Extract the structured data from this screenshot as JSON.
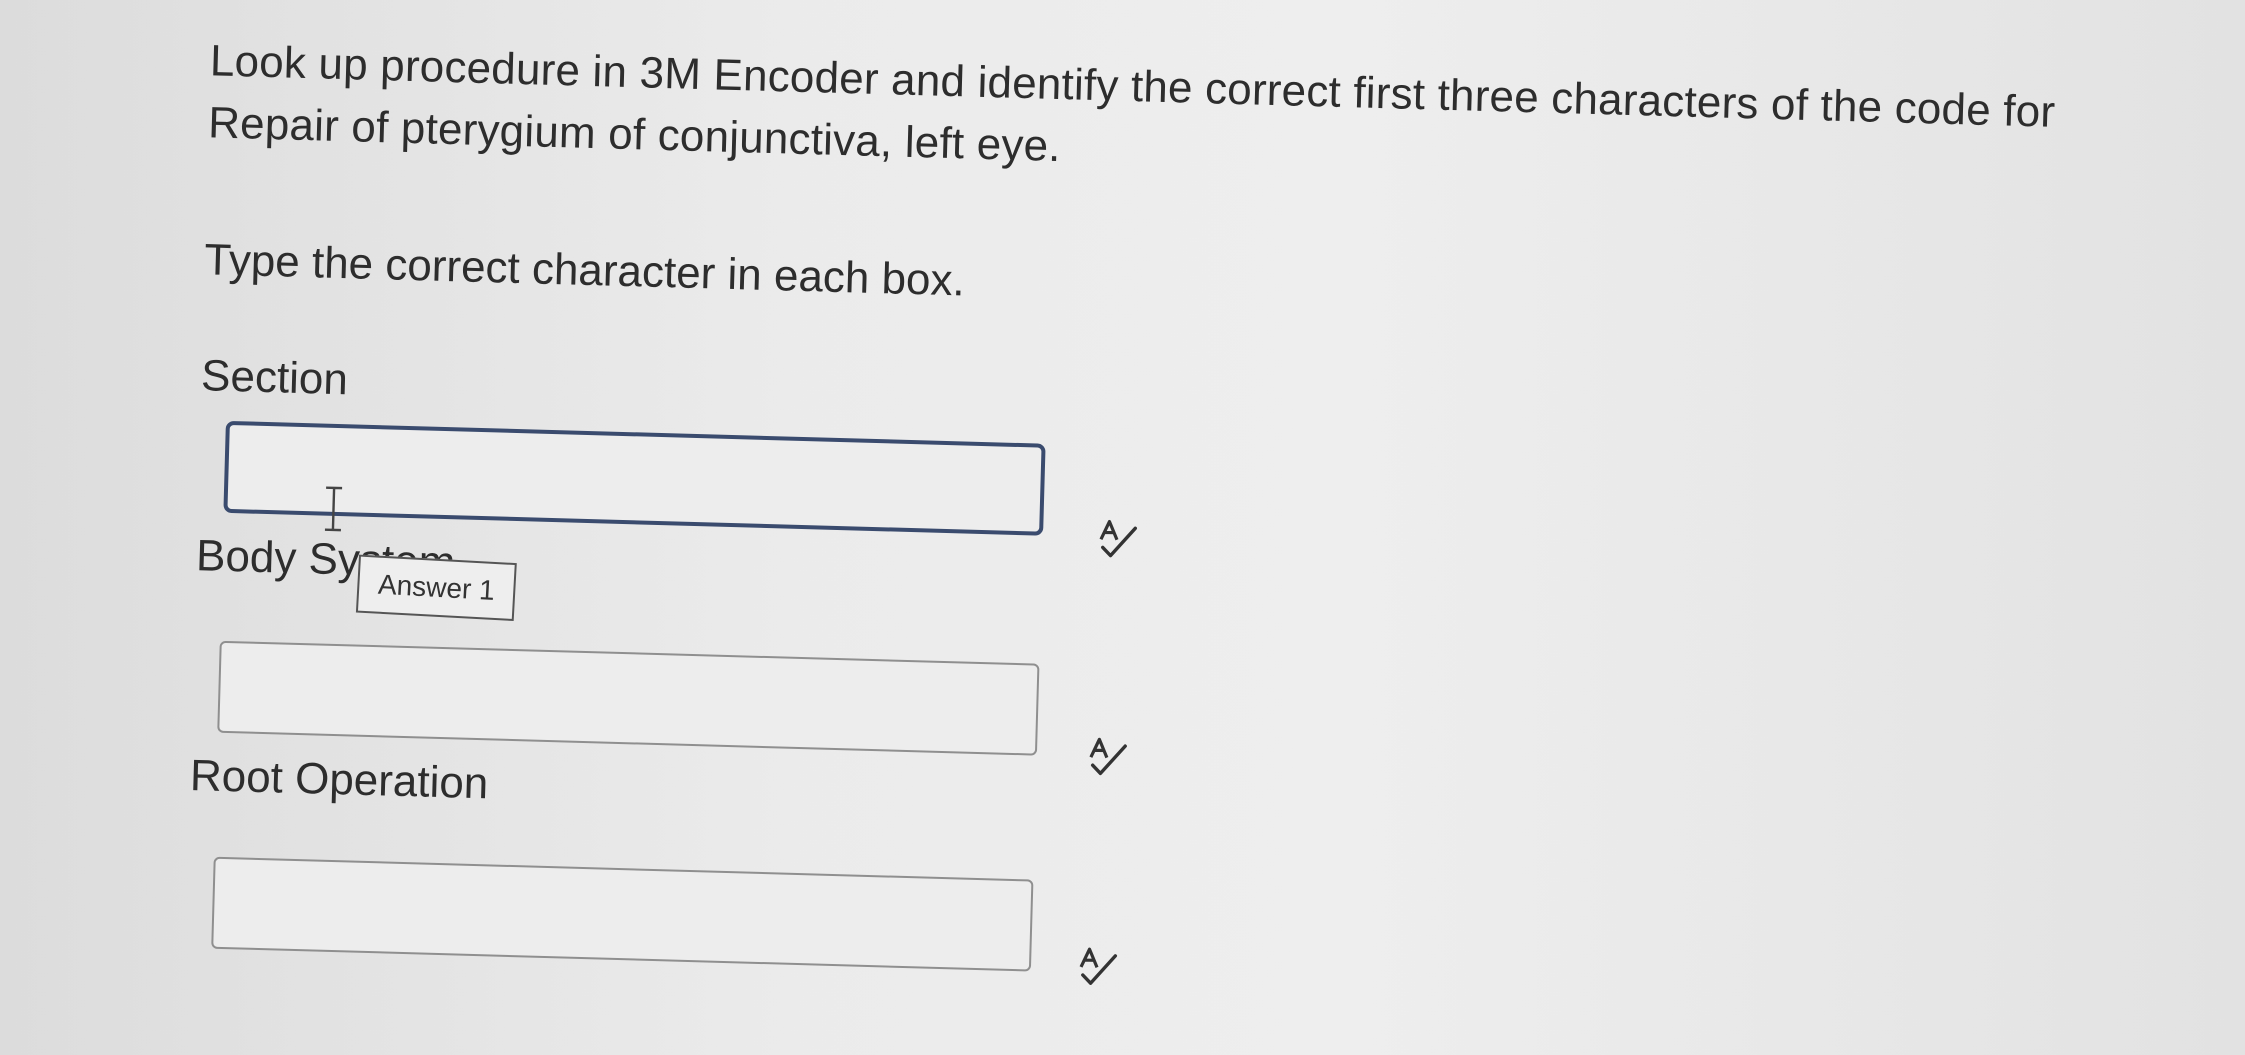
{
  "question": {
    "text": "Look up procedure in 3M Encoder and identify the correct first three characters of the code for Repair of pterygium of conjunctiva, left eye."
  },
  "instruction": "Type the correct character in each box.",
  "fields": [
    {
      "label": "Section",
      "value": "",
      "icon": "spellcheck-icon"
    },
    {
      "label": "Body System",
      "value": "",
      "icon": "spellcheck-icon"
    },
    {
      "label": "Root Operation",
      "value": "",
      "icon": "spellcheck-icon"
    }
  ],
  "tooltip": "Answer 1",
  "colors": {
    "background": "#e6e6e6",
    "text": "#2d2d2d",
    "focus_border": "#3a4b6e",
    "box_border": "#8f8f8f"
  }
}
